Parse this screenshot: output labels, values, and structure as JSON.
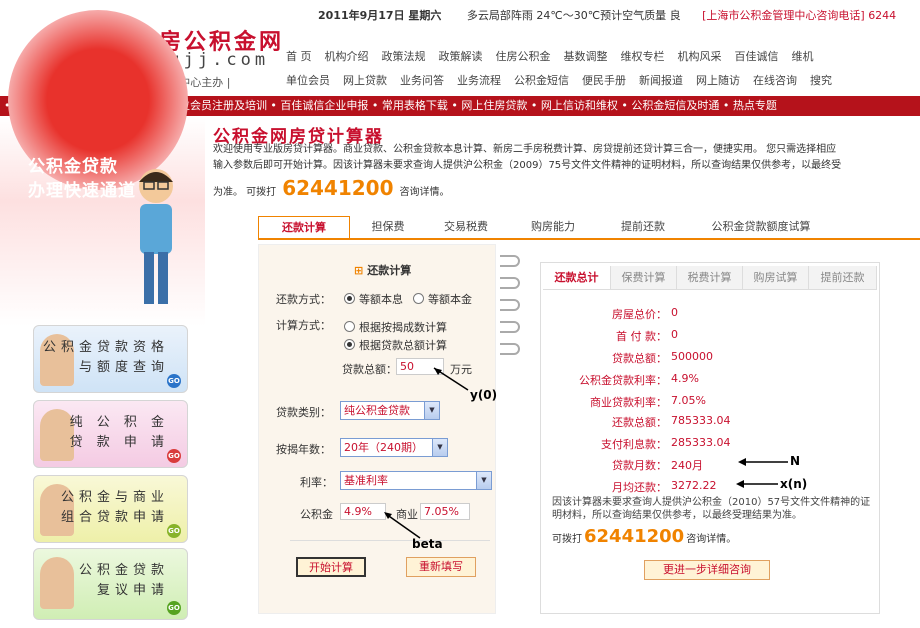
{
  "header": {
    "logo_cn": "上海住房公积金网",
    "logo_url": "www.shgjj.com",
    "logo_sub": "| 上海市公积金管理中心主办 |",
    "date": "2011年9月17日 星期六",
    "weather": "多云局部阵雨 24℃～30℃预计空气质量 良",
    "hotline": "[上海市公积金管理中心咨询电话] 6244",
    "nav1": [
      "首 页",
      "机构介绍",
      "政策法规",
      "政策解读",
      "住房公积金",
      "基数调整",
      "维权专栏",
      "机构风采",
      "百佳诚信",
      "维机"
    ],
    "nav2": [
      "单位会员",
      "网上贷款",
      "业务问答",
      "业务流程",
      "公积金短信",
      "便民手册",
      "新闻报道",
      "网上随访",
      "在线咨询",
      "搜究"
    ]
  },
  "ticker": "• 2011基数调整 • 公积金条例 • 单位会员注册及培训 • 百佳诚信企业申报 • 常用表格下载 • 网上住房贷款 • 网上信访和维权 • 公积金短信及时通 • 热点专题",
  "sidebar": {
    "promo_line1": "公积金贷款",
    "promo_line2": "办理快速通道",
    "cards": [
      {
        "line1": "公积金贷款资格",
        "line2": "与额度查询",
        "go": "GO"
      },
      {
        "line1": "纯 公 积 金",
        "line2": "贷 款 申 请",
        "go": "GO"
      },
      {
        "line1": "公积金与商业",
        "line2": "组合贷款申请",
        "go": "GO"
      },
      {
        "line1": "公积金贷款",
        "line2": "复议申请",
        "go": "GO"
      }
    ]
  },
  "main": {
    "title": "公积金网房贷计算器",
    "desc1": "欢迎使用专业版房贷计算器。商业贷款、公积金贷款本息计算、新房二手房税费计算、房贷提前还贷计算三合一，便捷实用。 您只需选择相应",
    "desc2": "输入参数后即可开始计算。因该计算器未要求查询人提供沪公积金（2009）75号文件文件精神的证明材料，所以查询结果仅供参考，以最终受",
    "phone_pre": "为准。 可拨打",
    "phone": "62441200",
    "phone_post": "咨询详情。",
    "tabs": [
      "还款计算",
      "担保费",
      "交易税费",
      "购房能力",
      "提前还款",
      "公积金贷款额度试算"
    ]
  },
  "form": {
    "heading": "还款计算",
    "repay_label": "还款方式：",
    "repay_opt1": "等额本息",
    "repay_opt2": "等额本金",
    "calc_label": "计算方式：",
    "calc_opt1": "根据按揭成数计算",
    "calc_opt2": "根据贷款总额计算",
    "total_label": "贷款总额：",
    "total_value": "50",
    "total_unit": "万元",
    "type_label": "贷款类别：",
    "type_value": "纯公积金贷款",
    "years_label": "按揭年数：",
    "years_value": "20年（240期）",
    "rate_label": "利率：",
    "rate_value": "基准利率",
    "gjj_label": "公积金",
    "gjj_value": "4.9%",
    "biz_label": "商业",
    "biz_value": "7.05%",
    "start_button": "开始计算",
    "reset_button": "重新填写"
  },
  "result": {
    "tabs": [
      "还款总计",
      "保费计算",
      "税费计算",
      "购房试算",
      "提前还款"
    ],
    "rows": [
      {
        "k": "房屋总价：",
        "v": "0"
      },
      {
        "k": "首 付 款：",
        "v": "0"
      },
      {
        "k": "贷款总额：",
        "v": "500000"
      },
      {
        "k": "公积金贷款利率：",
        "v": "4.9%"
      },
      {
        "k": "商业贷款利率：",
        "v": "7.05%"
      },
      {
        "k": "还款总额：",
        "v": "785333.04"
      },
      {
        "k": "支付利息款：",
        "v": "285333.04"
      },
      {
        "k": "贷款月数：",
        "v": "240月"
      },
      {
        "k": "月均还款：",
        "v": "3272.22"
      }
    ],
    "note": "因该计算器未要求查询人提供沪公积金（2010）57号文件文件精神的证明材料，所以查询结果仅供参考，以最终受理结果为准。",
    "phone_pre": "可拨打",
    "phone": "62441200",
    "phone_post": "咨询详情。",
    "more_button": "更进一步详细咨询"
  },
  "annotations": {
    "y0": "y(0)",
    "N": "N",
    "xn": "x(n)",
    "beta": "beta"
  },
  "colors": {
    "brand": "#c8102e",
    "accent": "#f08300",
    "bar": "#b5121b"
  }
}
